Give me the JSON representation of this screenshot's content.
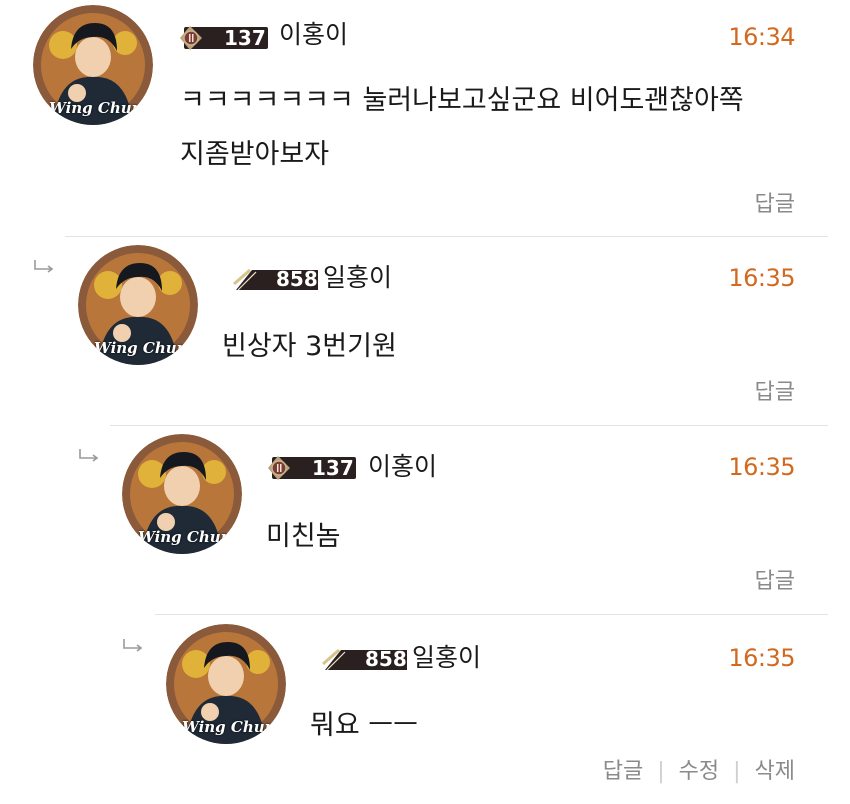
{
  "comments": [
    {
      "level": 0,
      "level_badge": "137",
      "nickname": "이홍이",
      "time": "16:34",
      "lines": [
        "ㅋㅋㅋㅋㅋㅋㅋ 눌러나보고싶군요 비어도괜찮아쪽",
        "지좀받아보자"
      ],
      "reply_label": "답글"
    },
    {
      "level": 1,
      "level_badge": "858",
      "nickname": "일홍이",
      "time": "16:35",
      "lines": [
        "빈상자 3번기원"
      ],
      "reply_label": "답글"
    },
    {
      "level": 2,
      "level_badge": "137",
      "nickname": "이홍이",
      "time": "16:35",
      "lines": [
        "미친놈"
      ],
      "reply_label": "답글"
    },
    {
      "level": 3,
      "level_badge": "858",
      "nickname": "일홍이",
      "time": "16:35",
      "lines": [
        "뭐요 ㅡㅡ"
      ],
      "reply_label": "답글",
      "edit_label": "수정",
      "delete_label": "삭제"
    }
  ],
  "avatar_caption": "Wing Chun",
  "colors": {
    "time": "#d2691e",
    "action": "#8a8a8a",
    "divider": "#e3e3e3"
  }
}
